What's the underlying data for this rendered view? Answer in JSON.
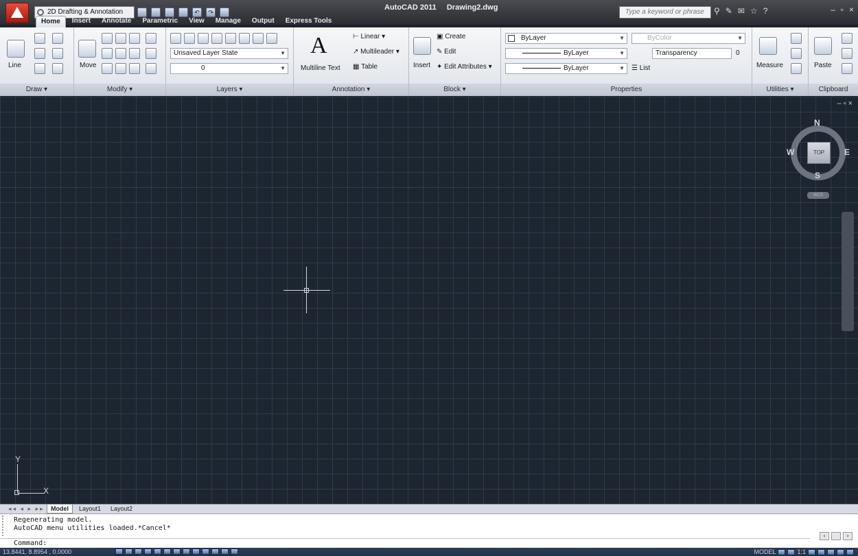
{
  "titlebar": {
    "workspace": "2D Drafting & Annotation",
    "app_name": "AutoCAD 2011",
    "document": "Drawing2.dwg",
    "search_placeholder": "Type a keyword or phrase"
  },
  "ribbon_tabs": [
    "Home",
    "Insert",
    "Annotate",
    "Parametric",
    "View",
    "Manage",
    "Output",
    "Express Tools"
  ],
  "panels": {
    "draw": {
      "title": "Draw",
      "line": "Line"
    },
    "modify": {
      "title": "Modify",
      "move": "Move"
    },
    "layers": {
      "title": "Layers",
      "layer_state": "Unsaved Layer State",
      "current_layer": "0"
    },
    "annotation": {
      "title": "Annotation",
      "multiline_text": "Multiline Text",
      "linear": "Linear",
      "multileader": "Multileader",
      "table": "Table"
    },
    "block": {
      "title": "Block",
      "insert": "Insert",
      "create": "Create",
      "edit": "Edit",
      "edit_attributes": "Edit Attributes"
    },
    "properties": {
      "title": "Properties",
      "color": "ByLayer",
      "lineweight": "ByLayer",
      "linetype": "ByLayer",
      "plot_style": "ByColor",
      "transparency": "Transparency",
      "transparency_value": "0",
      "list": "List"
    },
    "utilities": {
      "title": "Utilities",
      "measure": "Measure"
    },
    "clipboard": {
      "title": "Clipboard",
      "paste": "Paste"
    }
  },
  "viewcube": {
    "north": "N",
    "south": "S",
    "east": "E",
    "west": "W",
    "face": "TOP",
    "wcs": "WCS"
  },
  "ucs": {
    "x": "X",
    "y": "Y"
  },
  "layout_tabs": [
    "Model",
    "Layout1",
    "Layout2"
  ],
  "command_line": {
    "history": [
      "Regenerating model.",
      "AutoCAD menu utilities loaded.*Cancel*"
    ],
    "prompt": "Command:"
  },
  "statusbar": {
    "coordinates": "13.8441, 8.8954 , 0.0000",
    "model": "MODEL",
    "annotation_scale": "1:1"
  }
}
